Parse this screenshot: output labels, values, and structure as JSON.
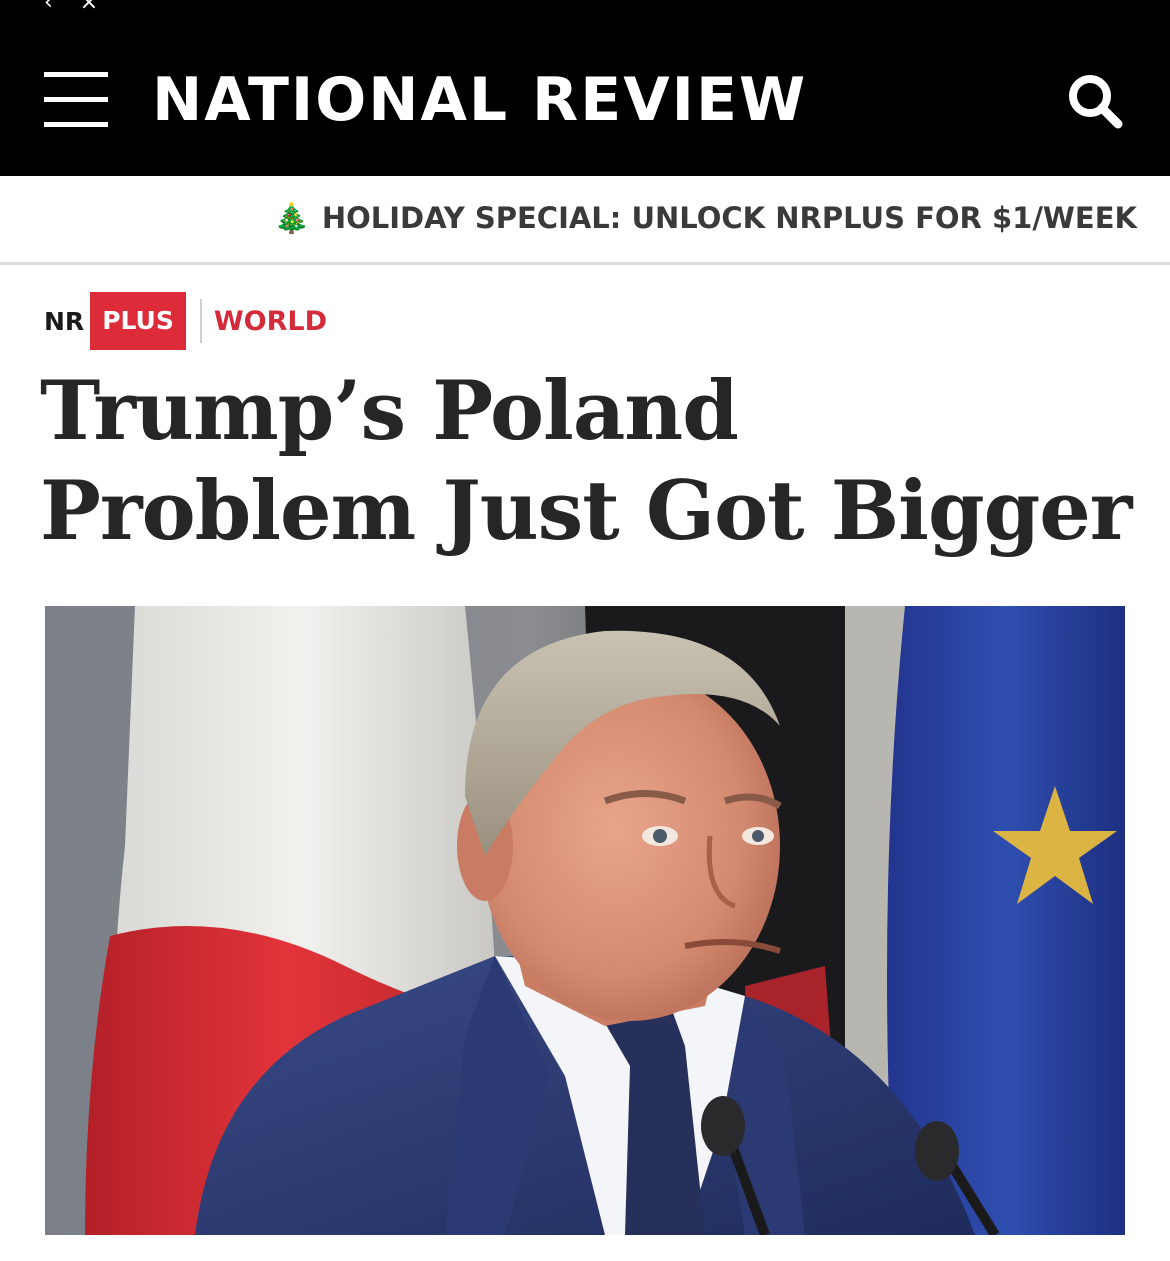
{
  "header": {
    "logo_text": "NATIONAL REVIEW",
    "menu_icon": "hamburger-menu-icon",
    "search_icon": "search-icon"
  },
  "promo": {
    "emoji": "🎄",
    "text": "HOLIDAY SPECIAL: UNLOCK NRPLUS FOR $1/WEEK"
  },
  "article": {
    "badge_nr": "NR",
    "badge_plus": "PLUS",
    "section": "WORLD",
    "headline": "Trump’s Poland Problem Just Got Bigger"
  },
  "colors": {
    "header_bg": "#000000",
    "accent_red": "#dd2b3a",
    "headline_text": "#262626"
  }
}
